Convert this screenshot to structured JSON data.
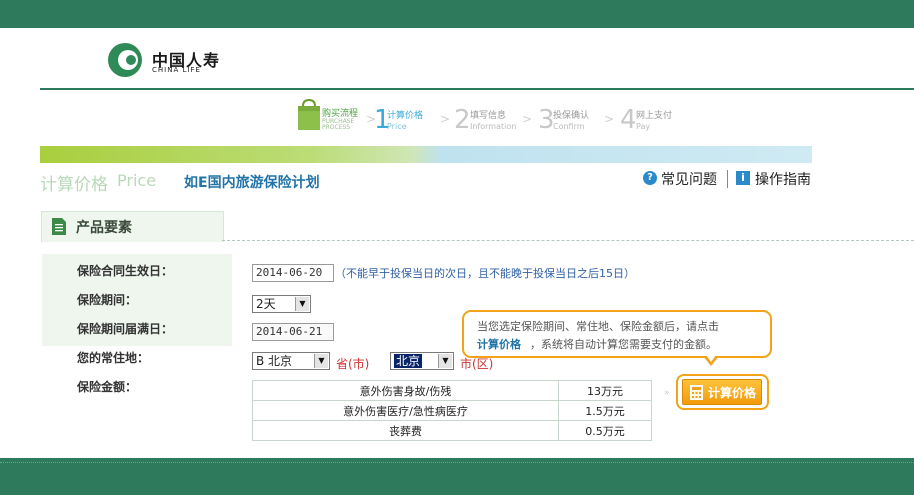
{
  "brand": {
    "name_cn": "中国人寿",
    "name_en": "CHINA LIFE",
    "color": "#2e7a5c",
    "logo_icon": "china-life-logo"
  },
  "flow": {
    "title_cn": "购买流程",
    "title_en": "PURCHASE PROCESS",
    "steps": [
      {
        "num": "1",
        "label": "计算价格",
        "sub": "Price",
        "active": true
      },
      {
        "num": "2",
        "label": "填写信息",
        "sub": "Information",
        "active": false
      },
      {
        "num": "3",
        "label": "投保确认",
        "sub": "Confirm",
        "active": false
      },
      {
        "num": "4",
        "label": "网上支付",
        "sub": "Pay",
        "active": false
      }
    ],
    "separator": ">"
  },
  "page": {
    "title_cn": "计算价格",
    "title_en": "Price",
    "plan_name": "如E国内旅游保险计划",
    "help_link": "常见问题",
    "guide_link": "操作指南"
  },
  "section": {
    "title": "产品要素"
  },
  "form": {
    "effective_date_label": "保险合同生效日：",
    "effective_date_value": "2014-06-20",
    "effective_date_hint": "（不能早于投保当日的次日，且不能晚于投保当日之后15日）",
    "period_label": "保险期间：",
    "period_value": "2天",
    "expiry_label": "保险期间届满日：",
    "expiry_value": "2014-06-21",
    "residence_label": "您的常住地：",
    "province_value": "B  北京",
    "province_suffix": "省(市)",
    "city_value": "北京",
    "city_suffix": "市(区)",
    "amount_label": "保险金额："
  },
  "coverage": {
    "rows": [
      {
        "item": "意外伤害身故/伤残",
        "amount": "13万元"
      },
      {
        "item": "意外伤害医疗/急性病医疗",
        "amount": "1.5万元"
      },
      {
        "item": "丧葬费",
        "amount": "0.5万元"
      }
    ]
  },
  "tooltip": {
    "line1": "当您选定保险期间、常住地、保险金额后，请点击",
    "link": "计算价格",
    "line2": "，系统将自动计算您需要支付的金额。"
  },
  "calc_button": {
    "label": "计算价格",
    "color": "#f2a318"
  }
}
